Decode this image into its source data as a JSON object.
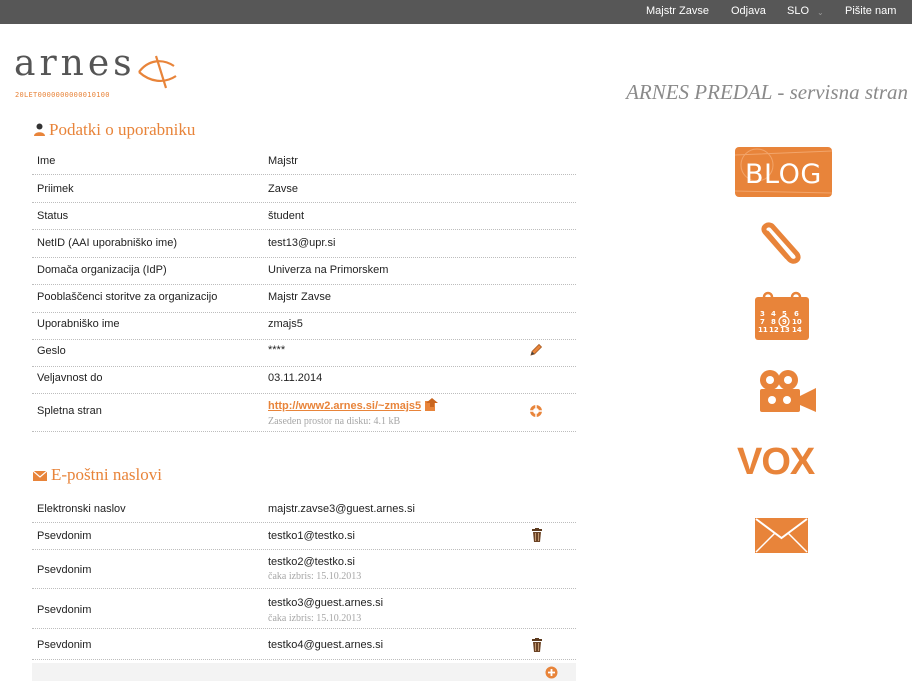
{
  "topbar": {
    "user": "Majstr Zavse",
    "logout": "Odjava",
    "lang": "SLO",
    "contact": "Pišite nam"
  },
  "logo": {
    "text": "arnes",
    "sub": "20LET0000000000010100"
  },
  "page_title": "ARNES PREDAL - servisna stran",
  "user_section": {
    "title": "Podatki o uporabniku",
    "rows": [
      {
        "label": "Ime",
        "value": "Majstr"
      },
      {
        "label": "Priimek",
        "value": "Zavse"
      },
      {
        "label": "Status",
        "value": "študent"
      },
      {
        "label": "NetID (AAI uporabniško ime)",
        "value": "test13@upr.si"
      },
      {
        "label": "Domača organizacija (IdP)",
        "value": "Univerza na Primorskem"
      },
      {
        "label": "Pooblaščenci storitve za organizacijo",
        "value": "Majstr Zavse"
      },
      {
        "label": "Uporabniško ime",
        "value": "zmajs5"
      },
      {
        "label": "Geslo",
        "value": "****"
      },
      {
        "label": "Veljavnost do",
        "value": "03.11.2014"
      },
      {
        "label": "Spletna stran",
        "value": "http://www2.arnes.si/~zmajs5",
        "sub": "Zaseden prostor na disku: 4.1 kB"
      }
    ]
  },
  "email_section": {
    "title": "E-poštni naslovi",
    "rows": [
      {
        "label": "Elektronski naslov",
        "value": "majstr.zavse3@guest.arnes.si"
      },
      {
        "label": "Psevdonim",
        "value": "testko1@testko.si"
      },
      {
        "label": "Psevdonim",
        "value": "testko2@testko.si",
        "sub": "čaka izbris: 15.10.2013"
      },
      {
        "label": "Psevdonim",
        "value": "testko3@guest.arnes.si",
        "sub": "čaka izbris: 15.10.2013"
      },
      {
        "label": "Psevdonim",
        "value": "testko4@guest.arnes.si"
      }
    ]
  },
  "sidebar": {
    "blog_label": "BLOG",
    "vox_label": "VOX",
    "calendar_numbers": "3 4 5 6 7 8 9 10 11 12 13 14"
  },
  "colors": {
    "accent": "#e8843a",
    "topbar": "#575757"
  },
  "icons": [
    "pencil-icon",
    "lifebuoy-icon",
    "upload-icon",
    "trash-icon",
    "plus-circle-icon",
    "user-icon",
    "envelope-icon",
    "paperclip-icon",
    "calendar-icon",
    "camera-icon"
  ]
}
